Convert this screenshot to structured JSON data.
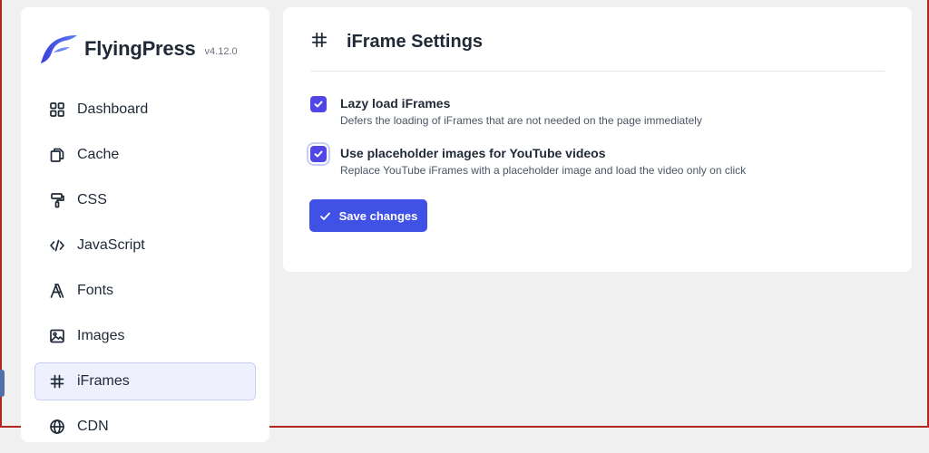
{
  "brand": {
    "name": "FlyingPress",
    "version": "v4.12.0"
  },
  "sidebar": {
    "items": [
      {
        "label": "Dashboard",
        "icon": "dashboard-grid-icon",
        "active": false
      },
      {
        "label": "Cache",
        "icon": "copy-files-icon",
        "active": false
      },
      {
        "label": "CSS",
        "icon": "paint-roller-icon",
        "active": false
      },
      {
        "label": "JavaScript",
        "icon": "code-brackets-icon",
        "active": false
      },
      {
        "label": "Fonts",
        "icon": "font-letter-icon",
        "active": false
      },
      {
        "label": "Images",
        "icon": "image-icon",
        "active": false
      },
      {
        "label": "iFrames",
        "icon": "hash-icon",
        "active": true
      },
      {
        "label": "CDN",
        "icon": "globe-icon",
        "active": false
      }
    ]
  },
  "panel": {
    "title": "iFrame Settings",
    "options": [
      {
        "title": "Lazy load iFrames",
        "description": "Defers the loading of iFrames that are not needed on the page immediately",
        "checked": true
      },
      {
        "title": "Use placeholder images for YouTube videos",
        "description": "Replace YouTube iFrames with a placeholder image and load the video only on click",
        "checked": true
      }
    ],
    "save_label": "Save changes"
  },
  "colors": {
    "accent": "#4f46e5",
    "button": "#4051e6",
    "active_bg": "#eef0fd",
    "page_bg": "#f0f0f1"
  }
}
